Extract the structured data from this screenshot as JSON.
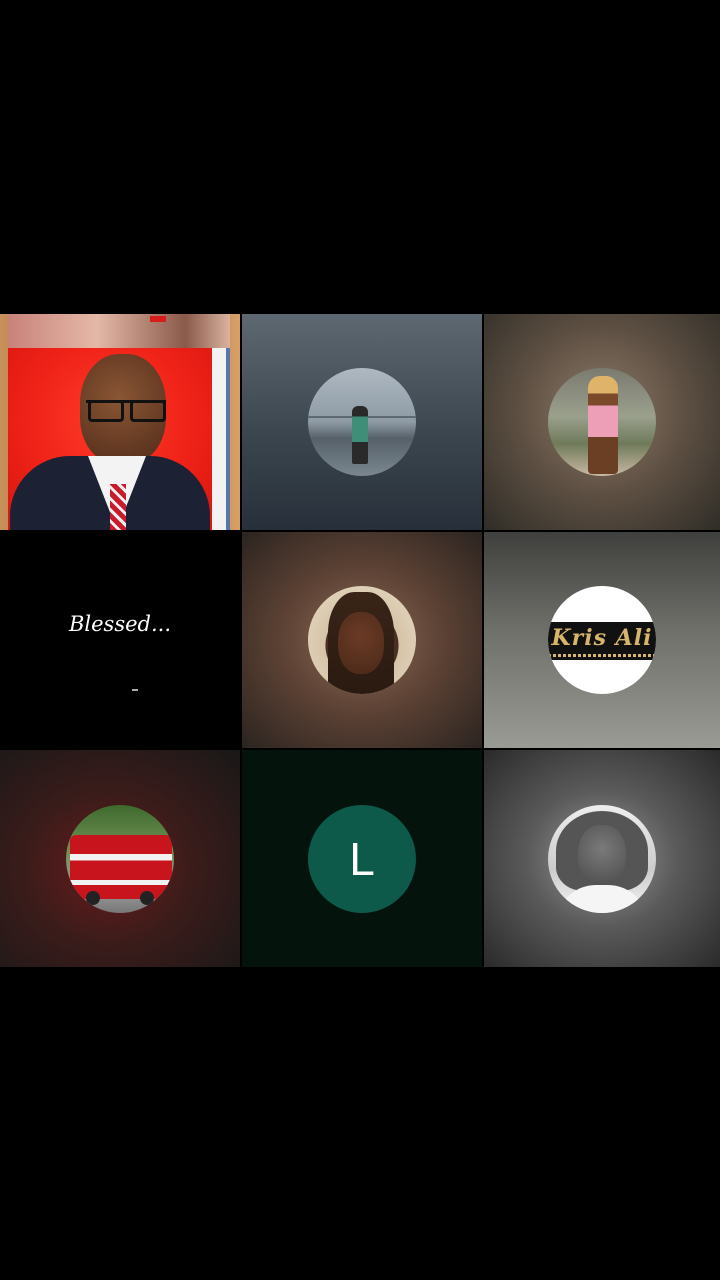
{
  "call": {
    "participants": [
      {
        "id": "p1",
        "type": "video"
      },
      {
        "id": "p2",
        "type": "avatar-photo",
        "photo": "person on beach"
      },
      {
        "id": "p3",
        "type": "avatar-photo",
        "photo": "woman in pink dress"
      },
      {
        "id": "p4",
        "type": "status-text",
        "text": "Blessed..."
      },
      {
        "id": "p5",
        "type": "avatar-photo",
        "photo": "woman portrait"
      },
      {
        "id": "p6",
        "type": "avatar-logo",
        "logo_text": "Kris Ali"
      },
      {
        "id": "p7",
        "type": "avatar-photo",
        "photo": "red double-decker bus"
      },
      {
        "id": "p8",
        "type": "avatar-initial",
        "initial": "L",
        "color": "#0d5a4a"
      },
      {
        "id": "p9",
        "type": "avatar-photo",
        "photo": "black and white portrait"
      }
    ]
  },
  "colors": {
    "background": "#000000",
    "initial_avatar": "#0d5a4a"
  }
}
